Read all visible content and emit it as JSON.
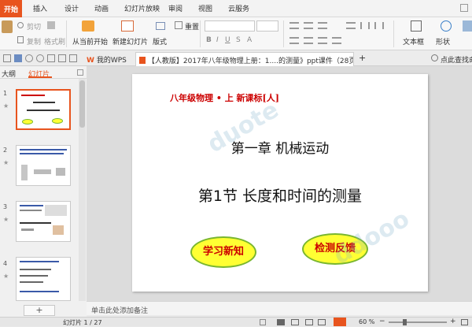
{
  "menu": {
    "tabs": [
      "开始",
      "插入",
      "设计",
      "动画",
      "幻灯片放映",
      "审阅",
      "视图",
      "云服务"
    ]
  },
  "ribbon": {
    "cut": "剪切",
    "copy": "复制",
    "format_painter": "格式刷",
    "from_current": "从当前开始",
    "new_slide": "新建幻灯片",
    "layout": "版式",
    "reset": "重置",
    "textbox": "文本框",
    "shapes": "形状"
  },
  "doc_tabs": {
    "my_wps": "我的WPS",
    "active_doc": "【人教版】2017年八年级物理上册：1....的测量》ppt课件（28页）.ppt",
    "add": "+",
    "search_hint": "点此查找命令"
  },
  "panel": {
    "outline_tab": "大纲",
    "slides_tab": "幻灯片",
    "thumb_numbers": [
      "1",
      "2",
      "3",
      "4"
    ],
    "add_button": "+"
  },
  "slide": {
    "subtitle": "八年级物理 • 上       新课标[人]",
    "chapter": "第一章    机械运动",
    "section": "第1节    长度和时间的测量",
    "btn_learn": "学习新知",
    "btn_test": "检测反馈"
  },
  "notes": {
    "placeholder": "单击此处添加备注"
  },
  "status": {
    "slide_counter": "幻灯片 1 / 27",
    "zoom": "60 %"
  },
  "colors": {
    "accent": "#e8541e",
    "slide_red": "#cc0000",
    "oval_fill": "#ffff33",
    "oval_border": "#79b62f"
  }
}
